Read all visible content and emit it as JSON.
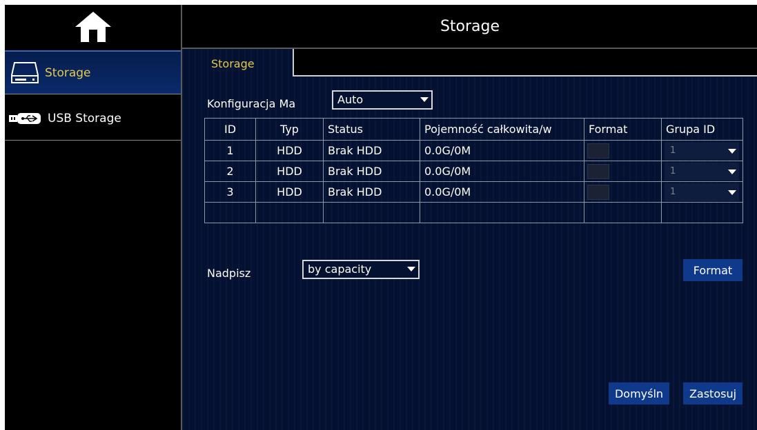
{
  "header": {
    "title": "Storage"
  },
  "sidebar": {
    "items": [
      {
        "label": "Storage",
        "icon": "hdd-icon"
      },
      {
        "label": "USB Storage",
        "icon": "usb-icon"
      }
    ]
  },
  "tabs": [
    {
      "label": "Storage"
    }
  ],
  "config": {
    "label": "Konfiguracja Ma",
    "value": "Auto"
  },
  "table": {
    "headers": [
      "ID",
      "Typ",
      "Status",
      "Pojemność całkowita/w",
      "Format",
      "Grupa ID"
    ],
    "rows": [
      {
        "id": "1",
        "type": "HDD",
        "status": "Brak HDD",
        "capacity": "0.0G/0M",
        "group": "1"
      },
      {
        "id": "2",
        "type": "HDD",
        "status": "Brak HDD",
        "capacity": "0.0G/0M",
        "group": "1"
      },
      {
        "id": "3",
        "type": "HDD",
        "status": "Brak HDD",
        "capacity": "0.0G/0M",
        "group": "1"
      }
    ]
  },
  "overwrite": {
    "label": "Nadpisz",
    "value": "by capacity"
  },
  "buttons": {
    "format": "Format",
    "default": "Domyśln",
    "apply": "Zastosuj"
  },
  "colors": {
    "accent": "#e6c94a",
    "button": "#0f3a8c",
    "panel": "#041130"
  }
}
